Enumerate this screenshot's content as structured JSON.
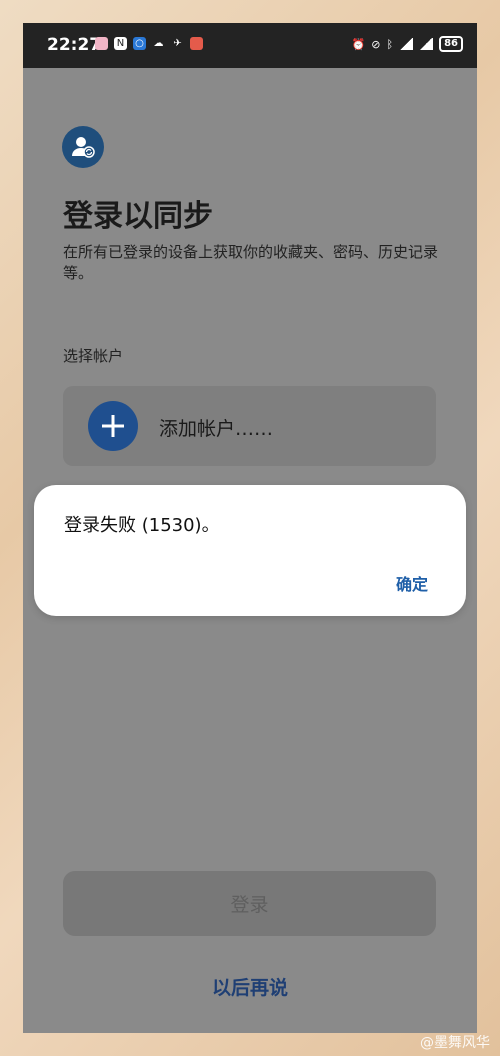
{
  "status_bar": {
    "time": "22:27",
    "battery": "86"
  },
  "page": {
    "title": "登录以同步",
    "subtitle": "在所有已登录的设备上获取你的收藏夹、密码、历史记录等。",
    "section_label": "选择帐户",
    "add_account_label": "添加帐户……",
    "login_button": "登录",
    "later_link": "以后再说"
  },
  "dialog": {
    "message": "登录失败 (1530)。",
    "ok_button": "确定"
  },
  "watermark": "@墨舞风华",
  "colors": {
    "accent": "#1f5fa8",
    "overlay": "#8a8a8a",
    "dialog_bg": "#ffffff"
  }
}
